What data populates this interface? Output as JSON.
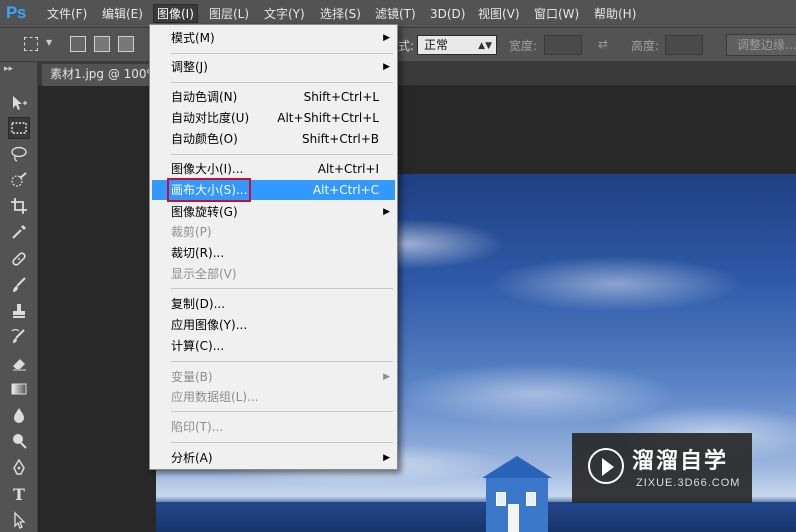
{
  "app": {
    "logo": "Ps"
  },
  "menubar": {
    "items": [
      {
        "label": "文件(F)",
        "active": false
      },
      {
        "label": "编辑(E)",
        "active": false
      },
      {
        "label": "图像(I)",
        "active": true
      },
      {
        "label": "图层(L)",
        "active": false
      },
      {
        "label": "文字(Y)",
        "active": false
      },
      {
        "label": "选择(S)",
        "active": false
      },
      {
        "label": "滤镜(T)",
        "active": false
      },
      {
        "label": "3D(D)",
        "active": false
      },
      {
        "label": "视图(V)",
        "active": false
      },
      {
        "label": "窗口(W)",
        "active": false
      },
      {
        "label": "帮助(H)",
        "active": false
      }
    ]
  },
  "options_bar": {
    "style_label_partial": "式:",
    "style_value": "正常",
    "width_label": "宽度:",
    "height_label": "高度:",
    "refine_edge_label": "调整边缘..."
  },
  "document": {
    "tab_title": "素材1.jpg @ 100%"
  },
  "tools": [
    {
      "name": "move-tool-icon",
      "active": false
    },
    {
      "name": "marquee-tool-icon",
      "active": true
    },
    {
      "name": "lasso-tool-icon",
      "active": false
    },
    {
      "name": "quick-selection-tool-icon",
      "active": false
    },
    {
      "name": "crop-tool-icon",
      "active": false
    },
    {
      "name": "eyedropper-tool-icon",
      "active": false
    },
    {
      "name": "healing-brush-tool-icon",
      "active": false
    },
    {
      "name": "brush-tool-icon",
      "active": false
    },
    {
      "name": "clone-stamp-tool-icon",
      "active": false
    },
    {
      "name": "history-brush-tool-icon",
      "active": false
    },
    {
      "name": "eraser-tool-icon",
      "active": false
    },
    {
      "name": "gradient-tool-icon",
      "active": false
    },
    {
      "name": "blur-tool-icon",
      "active": false
    },
    {
      "name": "dodge-tool-icon",
      "active": false
    },
    {
      "name": "pen-tool-icon",
      "active": false
    },
    {
      "name": "type-tool-icon",
      "active": false
    },
    {
      "name": "path-selection-tool-icon",
      "active": false
    }
  ],
  "image_menu": {
    "items": [
      {
        "label": "模式(M)",
        "shortcut": "",
        "submenu": true,
        "disabled": false,
        "highlight": false
      },
      {
        "label": "调整(J)",
        "shortcut": "",
        "submenu": true,
        "disabled": false,
        "highlight": false
      },
      {
        "label": "自动色调(N)",
        "shortcut": "Shift+Ctrl+L",
        "submenu": false,
        "disabled": false,
        "highlight": false
      },
      {
        "label": "自动对比度(U)",
        "shortcut": "Alt+Shift+Ctrl+L",
        "submenu": false,
        "disabled": false,
        "highlight": false
      },
      {
        "label": "自动颜色(O)",
        "shortcut": "Shift+Ctrl+B",
        "submenu": false,
        "disabled": false,
        "highlight": false
      },
      {
        "label": "图像大小(I)...",
        "shortcut": "Alt+Ctrl+I",
        "submenu": false,
        "disabled": false,
        "highlight": false
      },
      {
        "label": "画布大小(S)...",
        "shortcut": "Alt+Ctrl+C",
        "submenu": false,
        "disabled": false,
        "highlight": true
      },
      {
        "label": "图像旋转(G)",
        "shortcut": "",
        "submenu": true,
        "disabled": false,
        "highlight": false
      },
      {
        "label": "裁剪(P)",
        "shortcut": "",
        "submenu": false,
        "disabled": true,
        "highlight": false
      },
      {
        "label": "裁切(R)...",
        "shortcut": "",
        "submenu": false,
        "disabled": false,
        "highlight": false
      },
      {
        "label": "显示全部(V)",
        "shortcut": "",
        "submenu": false,
        "disabled": true,
        "highlight": false
      },
      {
        "label": "复制(D)...",
        "shortcut": "",
        "submenu": false,
        "disabled": false,
        "highlight": false
      },
      {
        "label": "应用图像(Y)...",
        "shortcut": "",
        "submenu": false,
        "disabled": false,
        "highlight": false
      },
      {
        "label": "计算(C)...",
        "shortcut": "",
        "submenu": false,
        "disabled": false,
        "highlight": false
      },
      {
        "label": "变量(B)",
        "shortcut": "",
        "submenu": true,
        "disabled": true,
        "highlight": false
      },
      {
        "label": "应用数据组(L)...",
        "shortcut": "",
        "submenu": false,
        "disabled": true,
        "highlight": false
      },
      {
        "label": "陷印(T)...",
        "shortcut": "",
        "submenu": false,
        "disabled": true,
        "highlight": false
      },
      {
        "label": "分析(A)",
        "shortcut": "",
        "submenu": true,
        "disabled": false,
        "highlight": false
      }
    ]
  },
  "watermark": {
    "title": "溜溜自学",
    "url": "ZIXUE.3D66.COM"
  },
  "colors": {
    "highlight": "#3399ff",
    "annotation_box": "#c8102e",
    "ps_blue": "#31a8ff"
  }
}
